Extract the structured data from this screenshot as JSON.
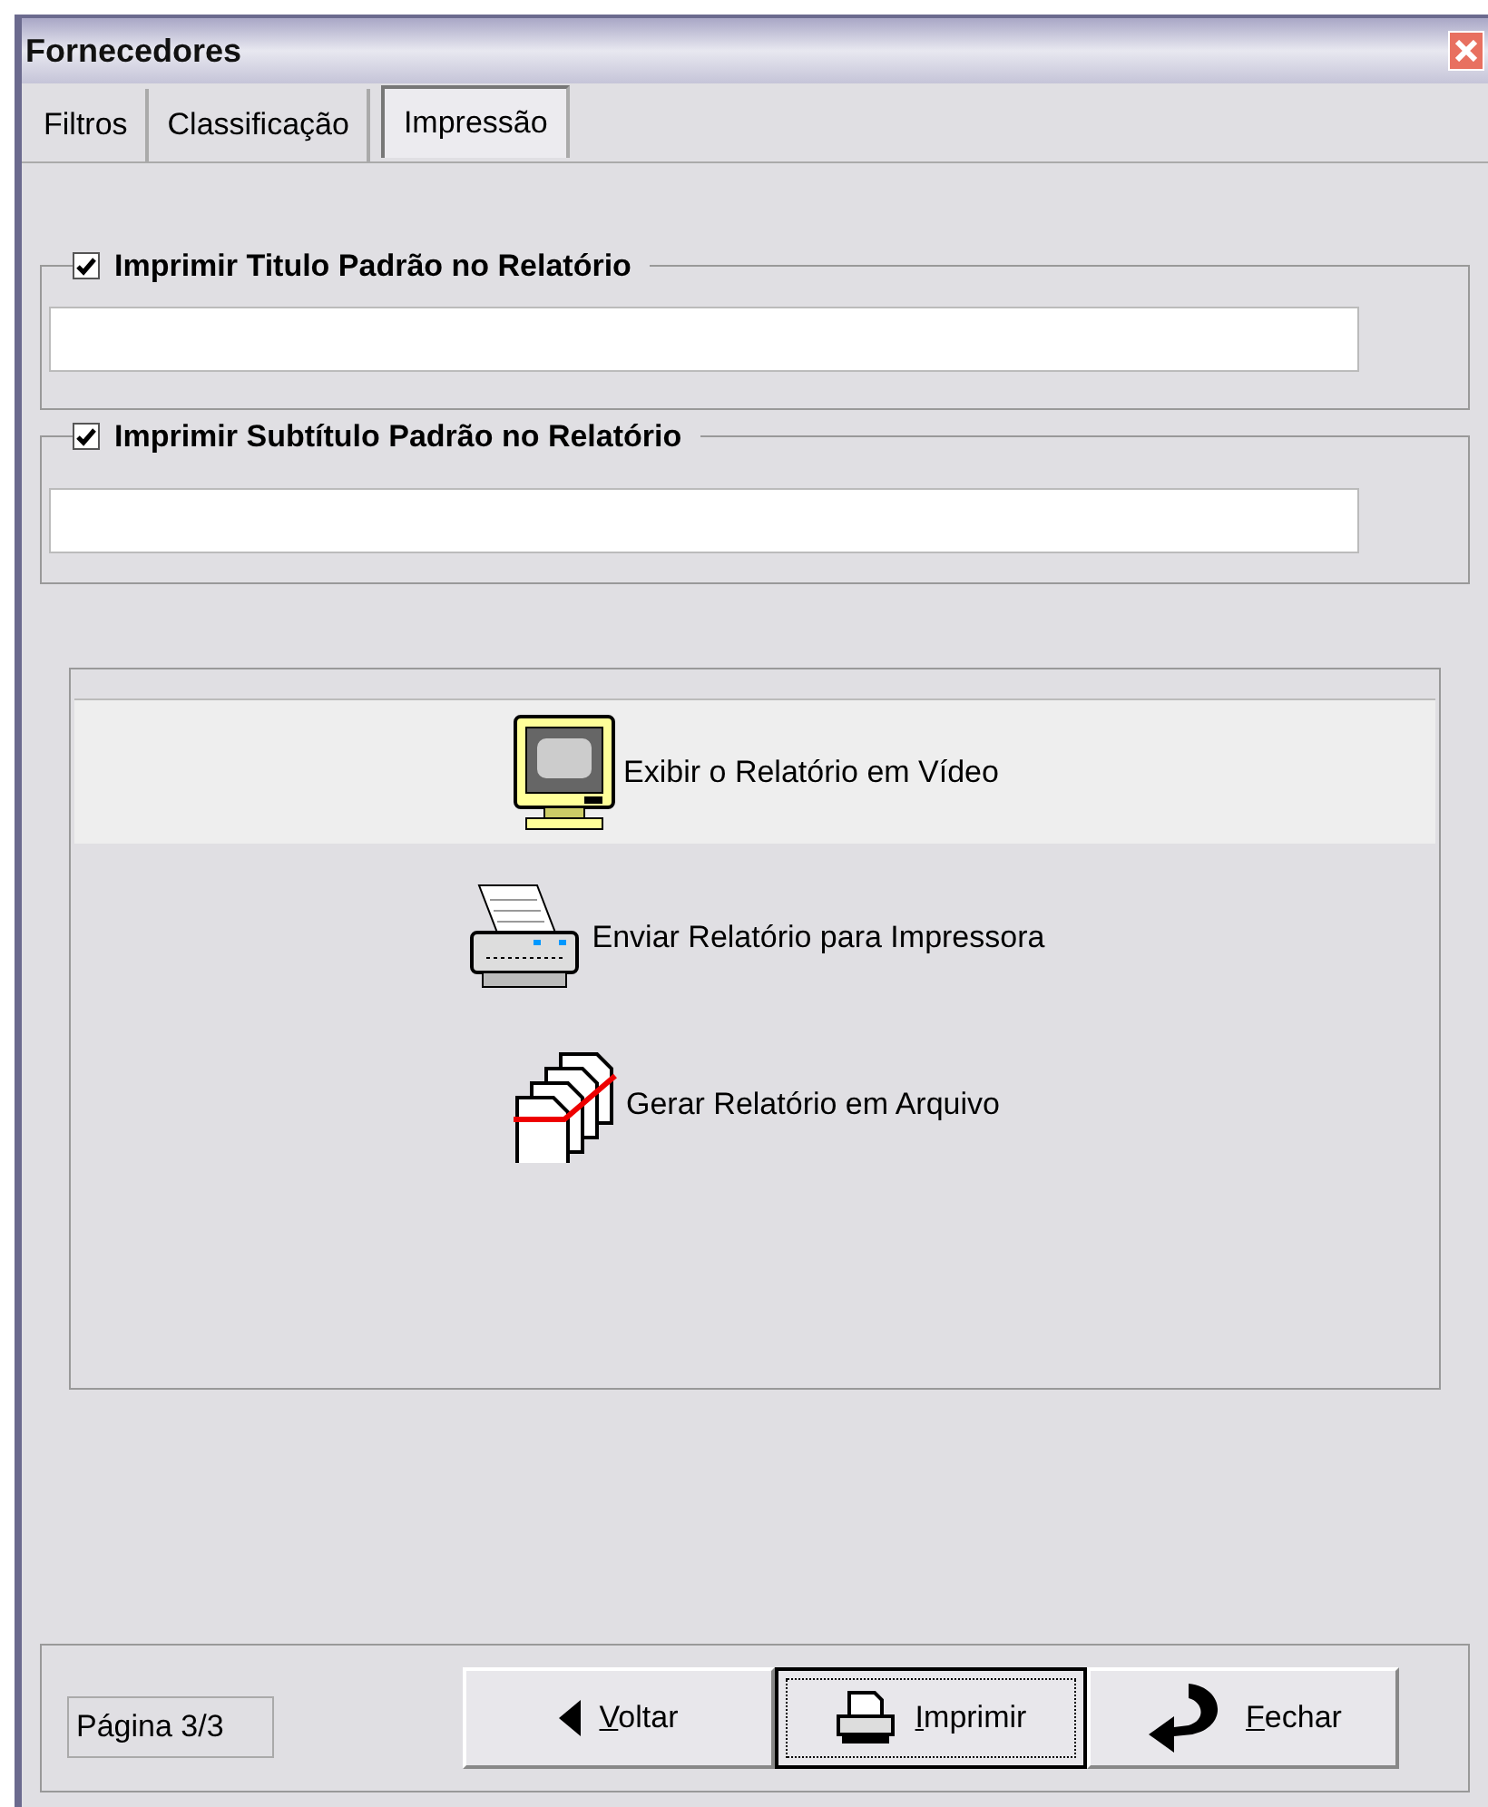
{
  "window": {
    "title": "Fornecedores"
  },
  "tabs": [
    {
      "label": "Filtros",
      "selected": false
    },
    {
      "label": "Classificação",
      "selected": false
    },
    {
      "label": "Impressão",
      "selected": true
    }
  ],
  "groups": [
    {
      "label": "Imprimir Titulo Padrão no Relatório",
      "checked": true
    },
    {
      "label": "Imprimir Subtítulo Padrão no Relatório",
      "checked": true
    }
  ],
  "output_options": [
    {
      "kind": "monitor",
      "label": "Exibir o Relatório em Vídeo",
      "selected": true
    },
    {
      "kind": "printer",
      "label": "Enviar Relatório para Impressora",
      "selected": false
    },
    {
      "kind": "files",
      "label": "Gerar Relatório em Arquivo",
      "selected": false
    }
  ],
  "status": "Página 3/3",
  "buttons": [
    {
      "kind": "back",
      "label": "Voltar",
      "selected": false
    },
    {
      "kind": "print",
      "label": "Imprimir",
      "selected": true
    },
    {
      "kind": "close",
      "label": "Fechar",
      "selected": false
    }
  ]
}
